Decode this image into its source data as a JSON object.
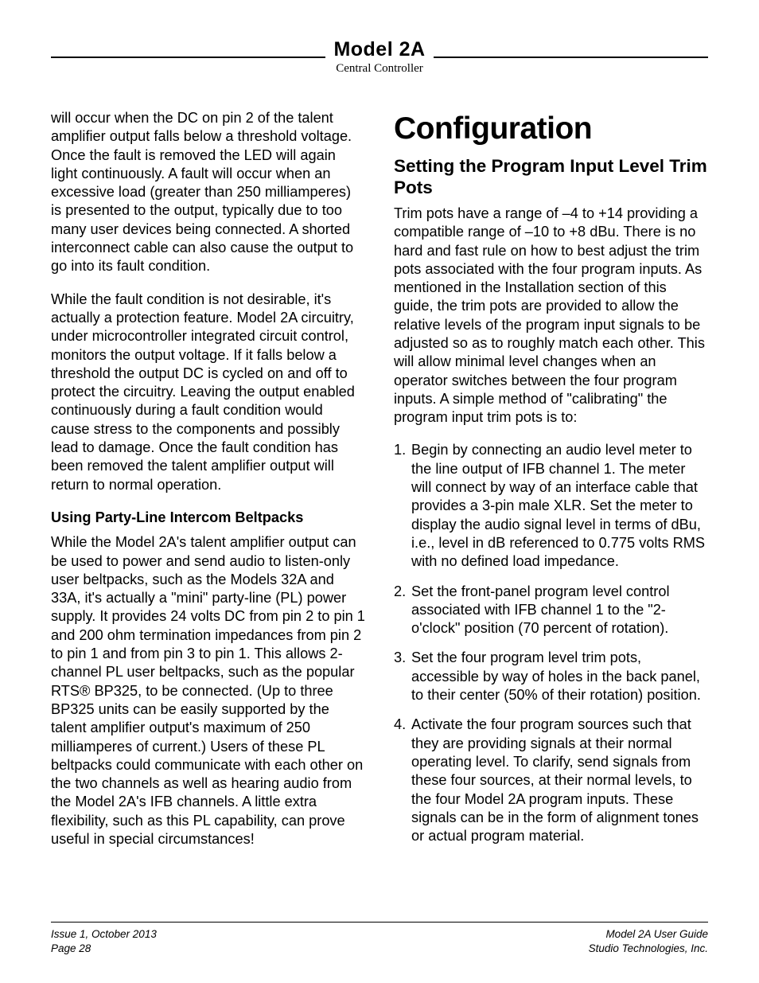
{
  "header": {
    "title": "Model 2A",
    "subtitle": "Central Controller"
  },
  "left_column": {
    "p1": "will occur when the DC on pin 2 of the talent amplifier output falls below a threshold voltage. Once the fault is removed the LED will again light continuously. A fault will occur when an excessive load (greater than 250 milliamperes) is presented to the output, typically due to too many user devices being connected. A shorted interconnect cable can also cause the output to go into its fault condition.",
    "p2": "While the fault condition is not desirable, it's actually a protection feature. Model 2A circuitry, under microcontroller integrated circuit control, monitors the output voltage. If it falls below a threshold the output DC is cycled on and off to protect the circuitry. Leaving the output enabled continuously during a fault condition would cause stress to the components and possibly lead to damage. Once the fault condition has been removed the talent amplifier output will return to normal operation.",
    "sub1": "Using Party-Line Intercom Beltpacks",
    "p3": "While the Model 2A's talent amplifier output can be used to power and send audio to listen-only user beltpacks, such as the Models 32A and 33A, it's actually a \"mini\" party-line (PL) power supply. It provides 24 volts DC from pin 2 to pin 1 and 200 ohm termination impedances from pin 2 to pin 1 and from pin 3 to pin 1. This allows 2-channel PL user beltpacks, such as the popular RTS® BP325, to be connected. (Up to three BP325 units can be easily supported by the talent amplifier output's maximum of 250 milliamperes of current.) Users of these PL beltpacks could communicate with each other on the two channels as well as hearing audio from the Model 2A's IFB channels. A little extra flexibility, such as this PL capability, can prove useful in special circumstances!"
  },
  "right_column": {
    "h1": "Configuration",
    "h2": "Setting the Program Input Level Trim Pots",
    "p1": "Trim pots have a range of –4 to +14 providing a compatible range of –10 to +8 dBu. There is no hard and fast rule on how to best adjust the trim pots associated with the four program inputs. As mentioned in the Installation section of this guide, the trim pots are provided to allow the relative levels of the program input signals to be adjusted so as to roughly match each other. This will allow minimal level changes when an operator switches between the four program inputs. A simple method of \"calibrating\" the program input trim pots is to:",
    "steps": [
      "Begin by connecting an audio level meter to the line output of IFB channel 1. The meter will connect by way of an interface cable that provides a 3-pin male XLR. Set the meter to display the audio signal level in terms of dBu, i.e., level in dB referenced to 0.775 volts RMS with no defined load impedance.",
      "Set the front-panel program level control associated with IFB channel 1 to the \"2-o'clock\" position (70 percent of rotation).",
      "Set the four program level trim pots, accessible by way of holes in the back panel, to their center (50% of their rotation) position.",
      "Activate the four program sources such that they are providing signals at their normal operating level. To clarify, send signals from these four sources, at their normal levels, to the four Model 2A program inputs. These signals can be in the form of alignment tones or actual program material."
    ]
  },
  "footer": {
    "left1": "Issue 1, October 2013",
    "left2": "Page 28",
    "right1": "Model 2A User Guide",
    "right2": "Studio Technologies, Inc."
  }
}
